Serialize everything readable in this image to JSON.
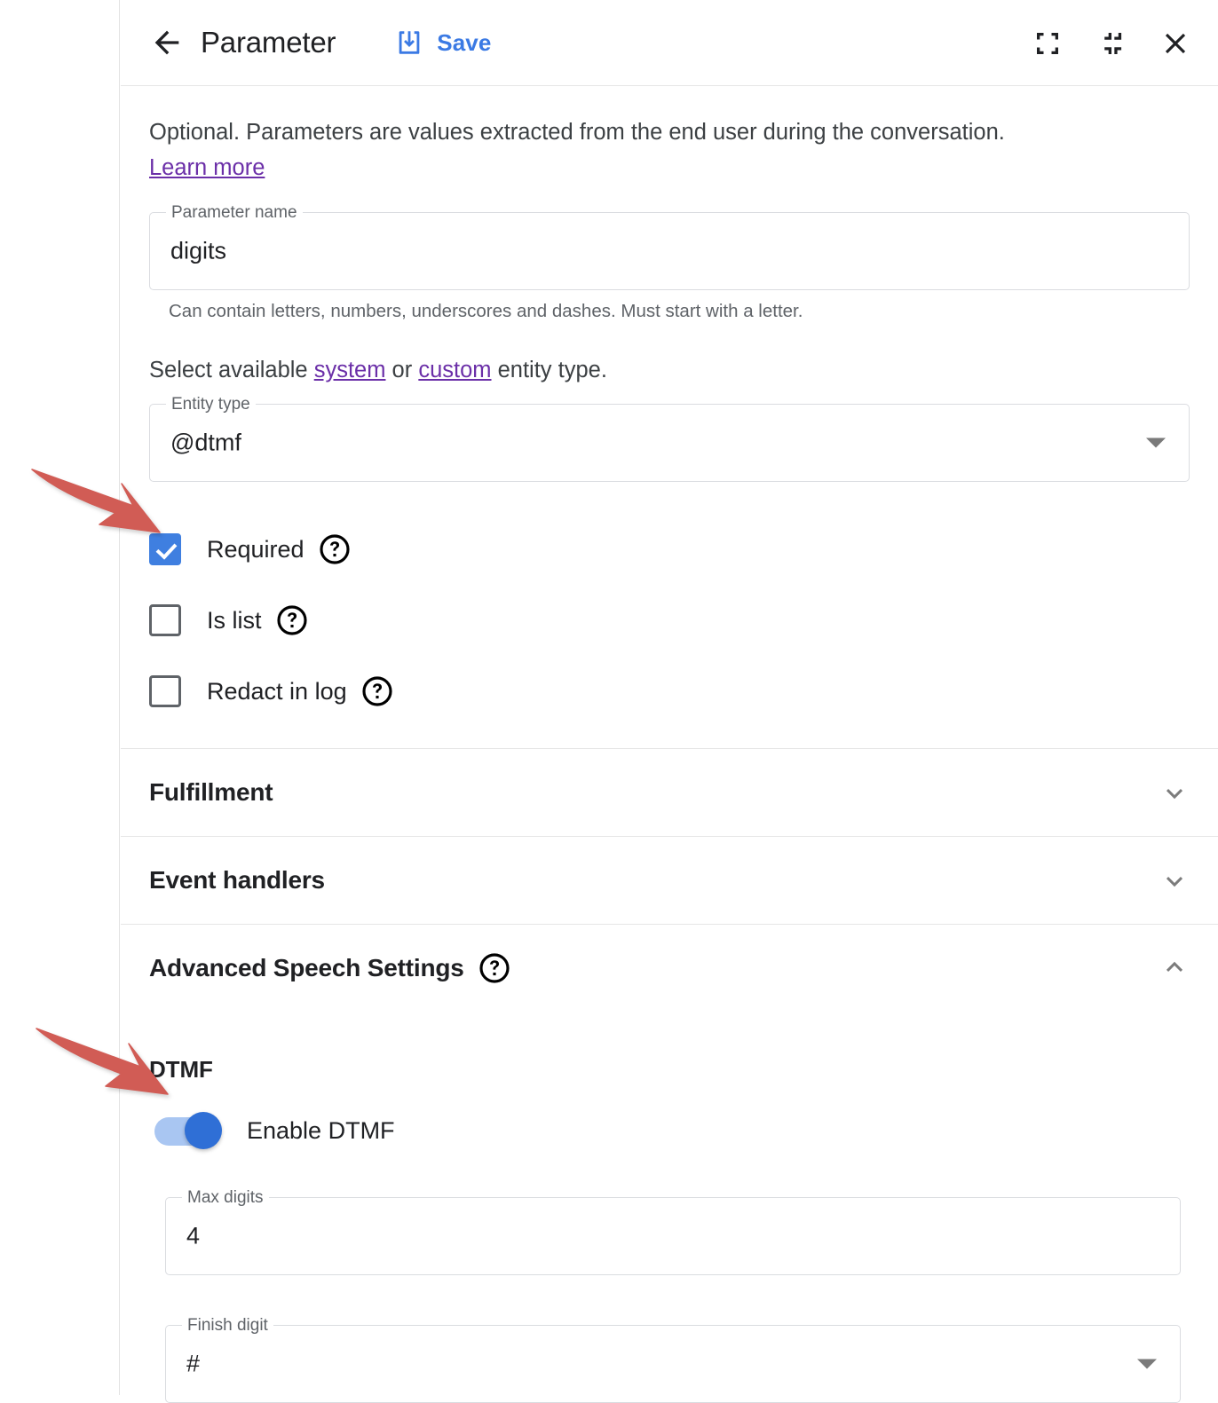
{
  "header": {
    "back_icon": "back-arrow-icon",
    "title": "Parameter",
    "save_icon": "save-icon",
    "save_label": "Save",
    "expand_icon": "expand-icon",
    "collapse_icon": "collapse-icon",
    "close_icon": "close-icon"
  },
  "intro": {
    "text": "Optional. Parameters are values extracted from the end user during the conversation.",
    "learn_more": "Learn more"
  },
  "parameter_name": {
    "label": "Parameter name",
    "value": "digits",
    "placeholder": "",
    "hint": "Can contain letters, numbers, underscores and dashes. Must start with a letter."
  },
  "entity_type": {
    "helper_prefix": "Select available ",
    "helper_link_system": "system",
    "helper_middle": " or ",
    "helper_link_custom": "custom",
    "helper_suffix": " entity type.",
    "label": "Entity type",
    "value": "@dtmf",
    "caret_icon": "dropdown-caret-icon"
  },
  "checkboxes": [
    {
      "label": "Required",
      "checked": true,
      "help_icon": "help-icon"
    },
    {
      "label": "Is list",
      "checked": false,
      "help_icon": "help-icon"
    },
    {
      "label": "Redact in log",
      "checked": false,
      "help_icon": "help-icon"
    }
  ],
  "sections": [
    {
      "title": "Fulfillment",
      "expanded": false,
      "chevron_icon": "chevron-down-icon",
      "has_help": false
    },
    {
      "title": "Event handlers",
      "expanded": false,
      "chevron_icon": "chevron-down-icon",
      "has_help": false
    },
    {
      "title": "Advanced Speech Settings",
      "expanded": true,
      "chevron_icon": "chevron-up-icon",
      "has_help": true,
      "help_icon": "help-icon"
    }
  ],
  "dtmf": {
    "heading": "DTMF",
    "toggle_label": "Enable DTMF",
    "toggle_on": true,
    "max_digits": {
      "label": "Max digits",
      "value": "4",
      "placeholder": ""
    },
    "finish_digit": {
      "label": "Finish digit",
      "value": "#",
      "caret_icon": "dropdown-caret-icon"
    }
  },
  "annotations": {
    "arrow_color": "#d15c55",
    "arrow_1_target": "required-checkbox",
    "arrow_2_target": "enable-dtmf-toggle"
  },
  "colors": {
    "accent_blue": "#3f7fe0",
    "link_purple": "#6b2fa8",
    "save_blue": "#3b7ae4",
    "toggle_track": "#a9c6f2",
    "toggle_thumb": "#2f6fd6",
    "arrow_red": "#d15c55"
  }
}
